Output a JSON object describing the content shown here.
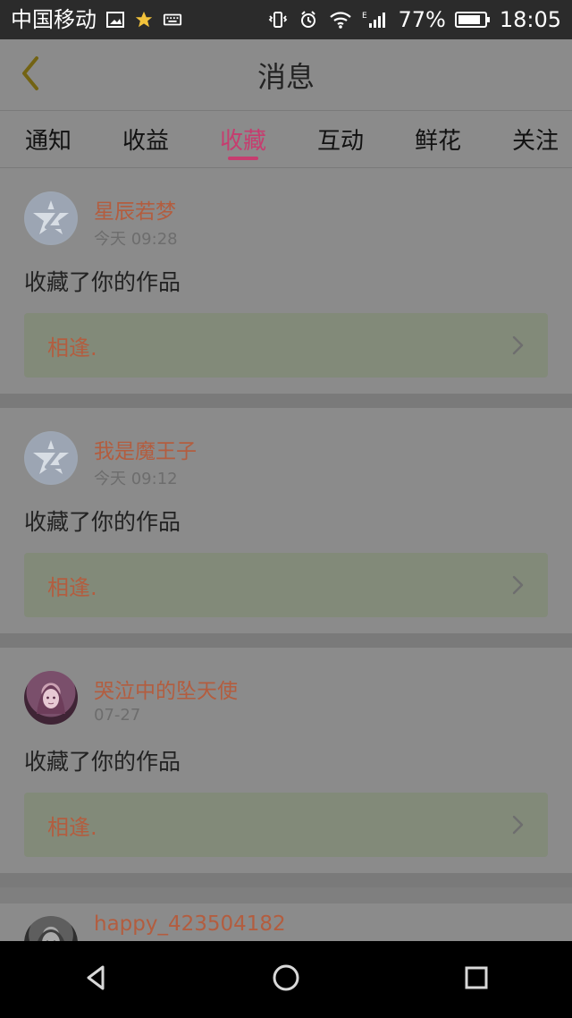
{
  "status_bar": {
    "carrier": "中国移动",
    "battery": "77%",
    "time": "18:05",
    "network": "E",
    "icons": {
      "image": "image-icon",
      "star": "star-icon",
      "keyboard": "keyboard-icon",
      "vibrate": "vibrate-icon",
      "alarm": "alarm-icon",
      "wifi": "wifi-icon",
      "signal": "signal-icon",
      "battery": "battery-icon"
    }
  },
  "header": {
    "title": "消息",
    "back_icon": "chevron-left-icon"
  },
  "tabs": [
    {
      "label": "通知"
    },
    {
      "label": "收益"
    },
    {
      "label": "收藏",
      "active": true
    },
    {
      "label": "互动"
    },
    {
      "label": "鲜花"
    },
    {
      "label": "关注"
    }
  ],
  "messages": [
    {
      "user_name": "星辰若梦",
      "time": "今天 09:28",
      "text": "收藏了你的作品",
      "work_title": "相逢.",
      "avatar_type": "default-avatar"
    },
    {
      "user_name": "我是魔王子",
      "time": "今天 09:12",
      "text": "收藏了你的作品",
      "work_title": "相逢.",
      "avatar_type": "default-avatar"
    },
    {
      "user_name": "哭泣中的坠天使",
      "time": "07-27",
      "text": "收藏了你的作品",
      "work_title": "相逢.",
      "avatar_type": "anime-avatar"
    },
    {
      "user_name": "happy_423504182",
      "avatar_type": "photo-avatar"
    }
  ],
  "colors": {
    "accent": "#c63d6f",
    "username": "#b35d3f",
    "status_bar": "#2b2b2b",
    "nav_bar": "#000000"
  },
  "nav_bar": {
    "back_icon": "nav-back-icon",
    "home_icon": "home-icon",
    "recents_icon": "recent-apps-icon"
  }
}
